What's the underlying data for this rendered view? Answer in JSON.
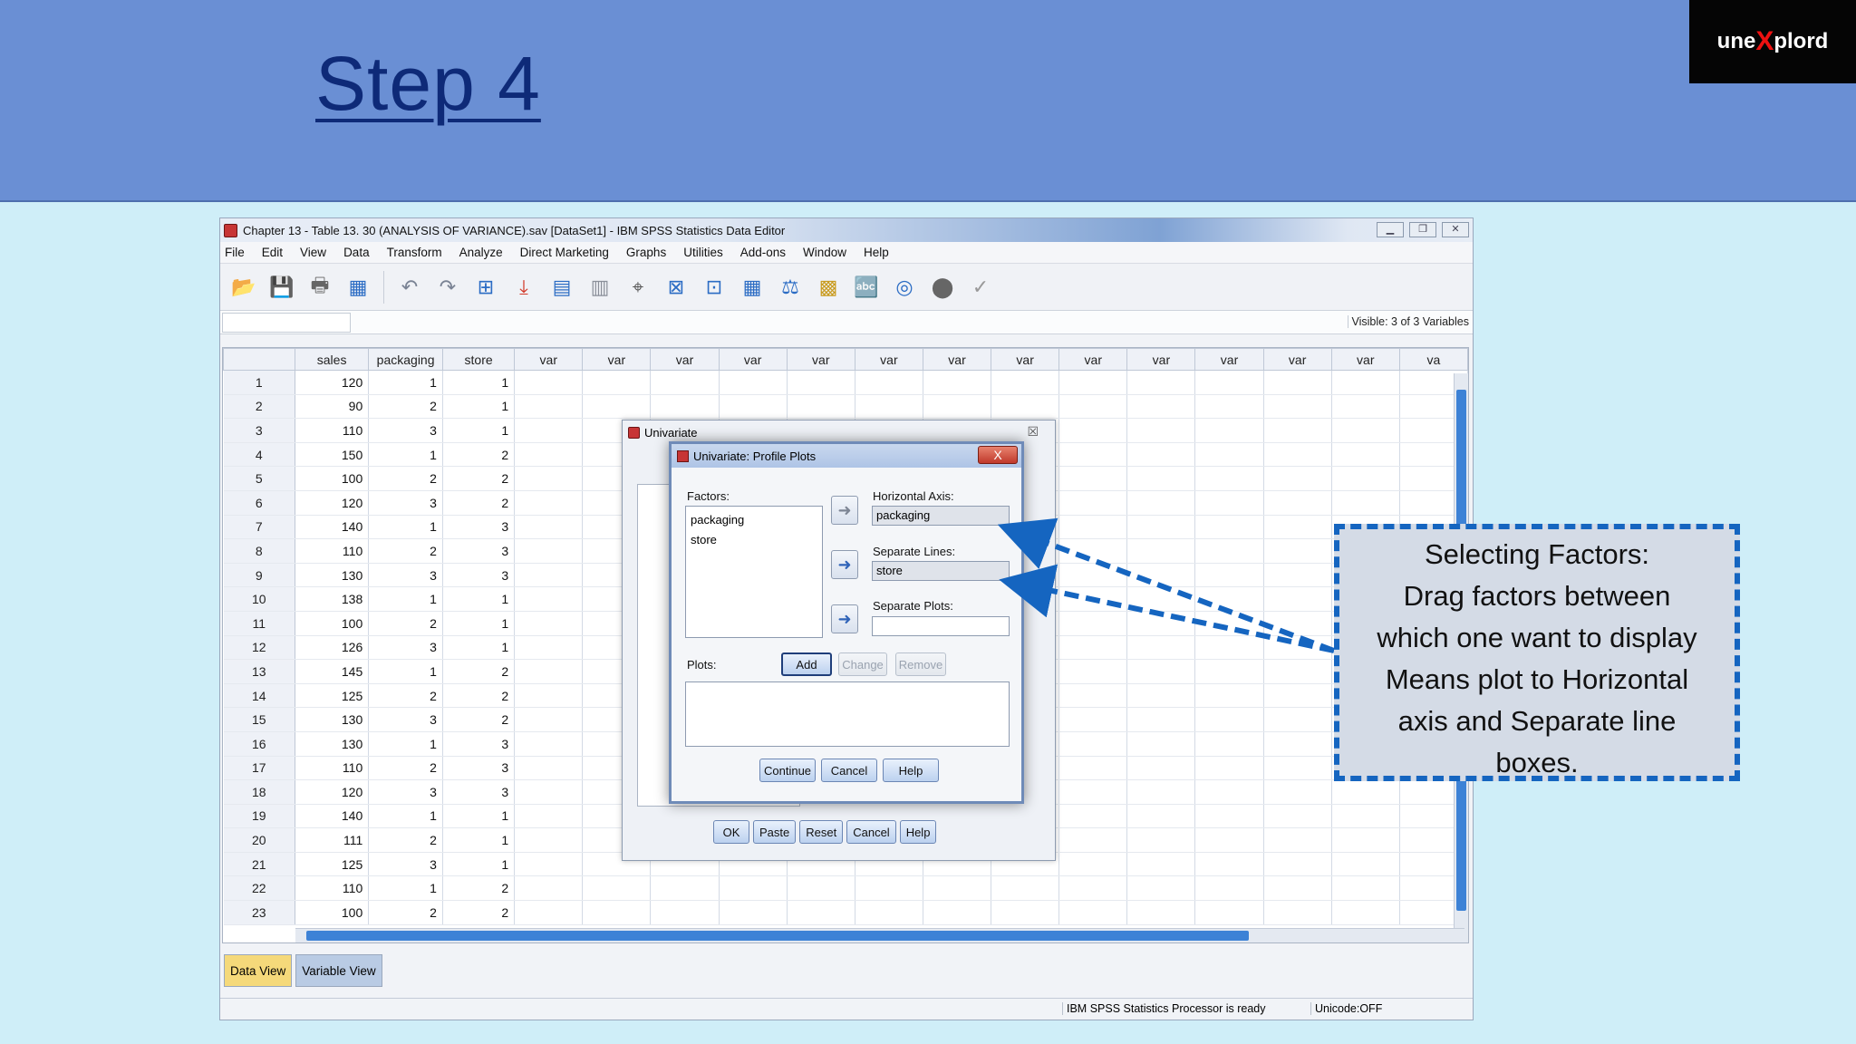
{
  "slide": {
    "title": "Step 4",
    "logo": {
      "left": "une",
      "x": "X",
      "right": "plord"
    }
  },
  "spss": {
    "window_title": "Chapter 13 - Table 13. 30 (ANALYSIS OF VARIANCE).sav [DataSet1] - IBM SPSS Statistics Data Editor",
    "menu": [
      "File",
      "Edit",
      "View",
      "Data",
      "Transform",
      "Analyze",
      "Direct Marketing",
      "Graphs",
      "Utilities",
      "Add-ons",
      "Window",
      "Help"
    ],
    "visible_label": "Visible: 3 of 3 Variables",
    "columns": [
      "sales",
      "packaging",
      "store",
      "var",
      "var",
      "var",
      "var",
      "var",
      "var",
      "var",
      "var",
      "var",
      "var",
      "var",
      "var",
      "var",
      "va"
    ],
    "rows": [
      [
        1,
        120,
        1,
        1
      ],
      [
        2,
        90,
        2,
        1
      ],
      [
        3,
        110,
        3,
        1
      ],
      [
        4,
        150,
        1,
        2
      ],
      [
        5,
        100,
        2,
        2
      ],
      [
        6,
        120,
        3,
        2
      ],
      [
        7,
        140,
        1,
        3
      ],
      [
        8,
        110,
        2,
        3
      ],
      [
        9,
        130,
        3,
        3
      ],
      [
        10,
        138,
        1,
        1
      ],
      [
        11,
        100,
        2,
        1
      ],
      [
        12,
        126,
        3,
        1
      ],
      [
        13,
        145,
        1,
        2
      ],
      [
        14,
        125,
        2,
        2
      ],
      [
        15,
        130,
        3,
        2
      ],
      [
        16,
        130,
        1,
        3
      ],
      [
        17,
        110,
        2,
        3
      ],
      [
        18,
        120,
        3,
        3
      ],
      [
        19,
        140,
        1,
        1
      ],
      [
        20,
        111,
        2,
        1
      ],
      [
        21,
        125,
        3,
        1
      ],
      [
        22,
        110,
        1,
        2
      ],
      [
        23,
        100,
        2,
        2
      ]
    ],
    "tabs": {
      "data_view": "Data View",
      "variable_view": "Variable View"
    },
    "status": {
      "ready": "IBM SPSS Statistics Processor is ready",
      "unicode": "Unicode:OFF"
    }
  },
  "univariate_dialog": {
    "title": "Univariate",
    "close": "☒",
    "buttons": [
      "OK",
      "Paste",
      "Reset",
      "Cancel",
      "Help"
    ]
  },
  "profile_dialog": {
    "title": "Univariate: Profile Plots",
    "close": "X",
    "factors_label": "Factors:",
    "factors": [
      "packaging",
      "store"
    ],
    "horizontal_label": "Horizontal Axis:",
    "horizontal_value": "packaging",
    "separate_lines_label": "Separate Lines:",
    "separate_lines_value": "store",
    "separate_plots_label": "Separate Plots:",
    "plots_label": "Plots:",
    "add": "Add",
    "change": "Change",
    "remove": "Remove",
    "continue": "Continue",
    "cancel": "Cancel",
    "help": "Help"
  },
  "callout": {
    "lines": [
      "Selecting Factors:",
      "Drag factors between",
      "which one want to display",
      "Means plot to Horizontal",
      "axis and Separate line",
      "boxes."
    ],
    "color": "#1565c0"
  }
}
